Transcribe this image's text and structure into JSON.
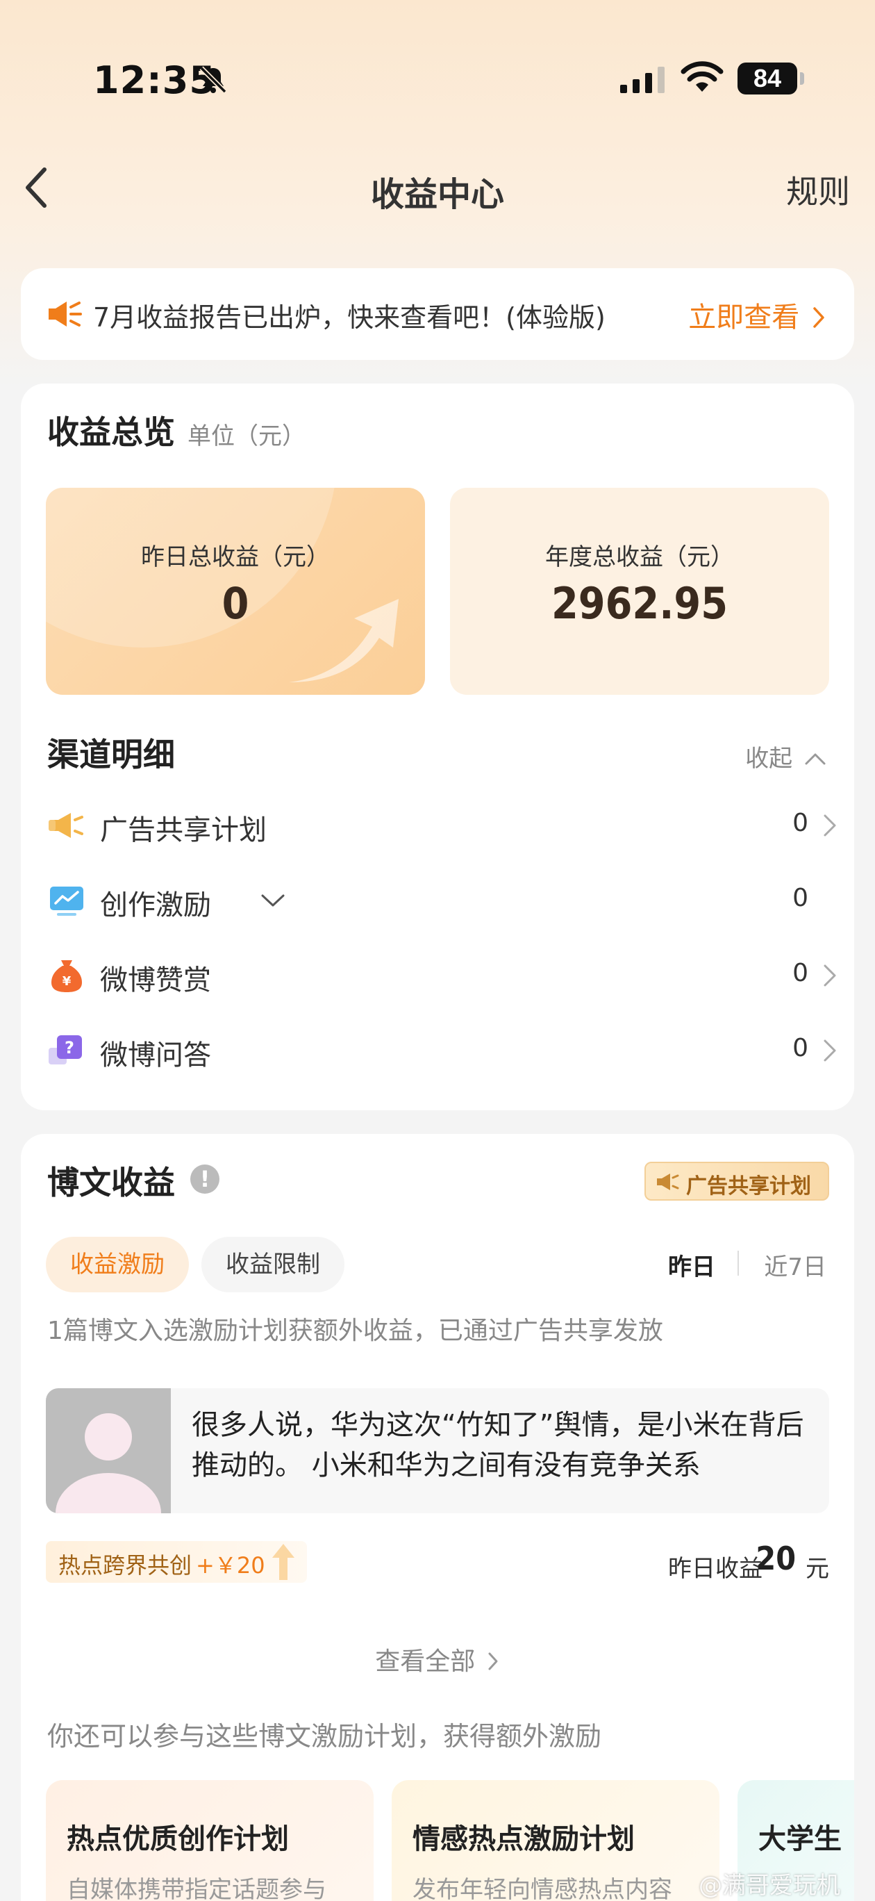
{
  "status_bar": {
    "time": "12:35",
    "battery": "84"
  },
  "nav": {
    "title": "收益中心",
    "rules_label": "规则"
  },
  "notice": {
    "text": "7月收益报告已出炉，快来查看吧！(体验版)",
    "action": "立即查看"
  },
  "overview": {
    "title": "收益总览",
    "unit": "单位（元）",
    "yesterday_label": "昨日总收益（元）",
    "yesterday_value": "0",
    "annual_label": "年度总收益（元）",
    "annual_value": "2962.95"
  },
  "channels": {
    "title": "渠道明细",
    "collapse_label": "收起",
    "items": [
      {
        "label": "广告共享计划",
        "value": "0",
        "icon": "megaphone-icon"
      },
      {
        "label": "创作激励",
        "value": "0",
        "icon": "trend-chart-icon"
      },
      {
        "label": "微博赞赏",
        "value": "0",
        "icon": "money-bag-icon"
      },
      {
        "label": "微博问答",
        "value": "0",
        "icon": "question-bubble-icon"
      }
    ]
  },
  "posts": {
    "title": "博文收益",
    "badge": "广告共享计划",
    "tabs": [
      "收益激励",
      "收益限制"
    ],
    "periods": [
      "昨日",
      "近7日"
    ],
    "description": "1篇博文入选激励计划获额外收益，已通过广告共享发放",
    "post": {
      "text": "很多人说，华为这次“竹知了”舆情，是小米在背后推动的。 小米和华为之间有没有竞争关系"
    },
    "hot_tag": {
      "label": "热点跨界共创",
      "amount": "+￥20"
    },
    "yesterday_label": "昨日收益",
    "yesterday_value": "20",
    "yesterday_unit": "元",
    "view_all": "查看全部",
    "invite": "你还可以参与这些博文激励计划，获得额外激励",
    "plans": [
      {
        "title": "热点优质创作计划",
        "desc": "自媒体携带指定话题参与"
      },
      {
        "title": "情感热点激励计划",
        "desc": "发布年轻向情感热点内容"
      },
      {
        "title": "大学生",
        "desc": ""
      }
    ]
  },
  "watermark": "@满哥爱玩机",
  "colors": {
    "accent": "#f07d1a",
    "badge_text": "#a06216"
  }
}
